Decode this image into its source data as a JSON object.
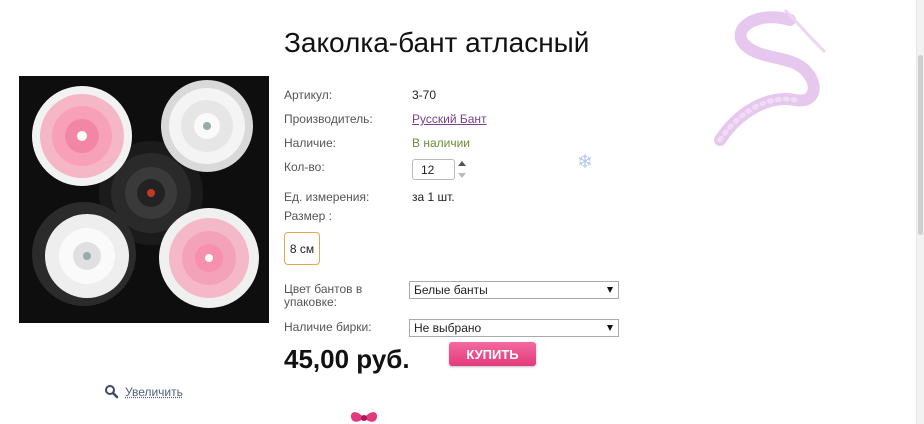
{
  "product": {
    "title": "Заколка-бант атласный"
  },
  "gallery": {
    "zoom_label": "Увеличить"
  },
  "attributes": {
    "article_label": "Артикул:",
    "article_value": "3-70",
    "manufacturer_label": "Производитель:",
    "manufacturer_value": "Русский Бант",
    "availability_label": "Наличие:",
    "availability_value": "В наличии",
    "qty_label": "Кол-во:",
    "qty_value": "12",
    "unit_label": "Ед. измерения:",
    "unit_value": "за 1 шт.",
    "size_label": "Размер :",
    "size_option": "8 см"
  },
  "options": {
    "color_label_line1": "Цвет бантов в",
    "color_label_line2": "упаковке:",
    "color_value": "Белые банты",
    "tag_label": "Наличие бирки:",
    "tag_value": "Не выбрано"
  },
  "purchase": {
    "price": "45,00 руб.",
    "buy_label": "КУПИТЬ"
  },
  "colors": {
    "accent_pink": "#e23a7c",
    "link_purple": "#7b3f8c",
    "in_stock_green": "#6c8f38",
    "size_border": "#e2a64f"
  },
  "icons": {
    "zoom": "magnifier-icon",
    "decor": "snowflake-icon"
  }
}
